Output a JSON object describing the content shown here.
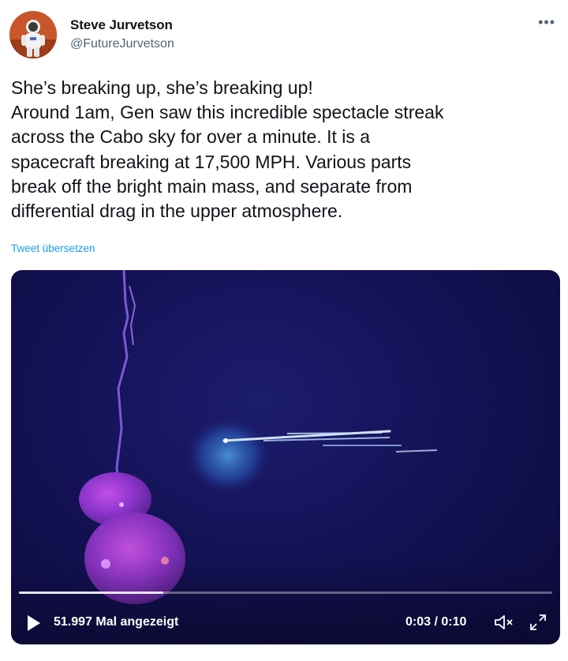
{
  "author": {
    "name": "Steve Jurvetson",
    "handle": "@FutureJurvetson",
    "avatar_icon": "astronaut-avatar"
  },
  "more_icon": "more-options-icon",
  "tweet": {
    "lines": [
      "She’s breaking up, she’s breaking up!",
      "Around 1am, Gen saw this incredible spectacle streak",
      "across the Cabo sky for over a minute. It is a",
      "spacecraft breaking at 17,500 MPH. Various parts",
      "break off the bright main mass, and separate from",
      "differential drag in the upper atmosphere."
    ],
    "translate_label": "Tweet übersetzen"
  },
  "video": {
    "views_label": "51.997 Mal angezeigt",
    "time_label": "0:03 / 0:10",
    "progress_fraction": 0.27,
    "icons": [
      "play-icon",
      "mute-icon",
      "fullscreen-icon"
    ]
  },
  "colors": {
    "link": "#1d9bf0",
    "text": "#0f1419",
    "secondary": "#536471"
  }
}
